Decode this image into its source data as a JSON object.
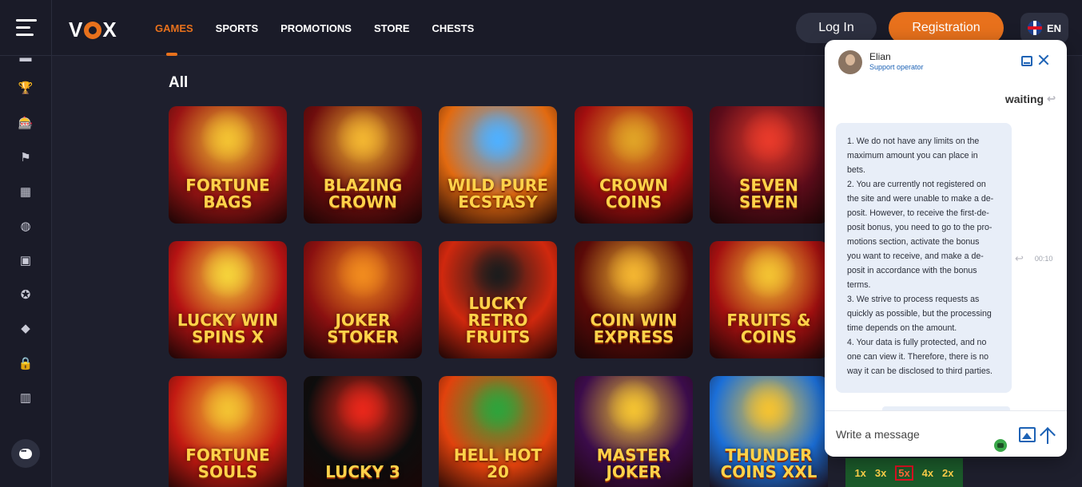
{
  "header": {
    "logo": "VOX",
    "nav": [
      "GAMES",
      "SPORTS",
      "PROMOTIONS",
      "STORE",
      "CHESTS"
    ],
    "active_nav": "GAMES",
    "login_label": "Log In",
    "register_label": "Registration",
    "language": "EN"
  },
  "sidebar": {
    "icons": [
      "menu-partial-icon",
      "trophy-icon",
      "casino-icon",
      "flag-icon",
      "calendar-icon",
      "basketball-icon",
      "tv-icon",
      "award-icon",
      "diamond-icon",
      "lock-icon",
      "leaderboard-icon"
    ],
    "chat_icon": "chat-bubble-icon"
  },
  "main": {
    "section_title": "All",
    "games": [
      {
        "title": "FORTUNE BAGS",
        "bg": "#9a1414",
        "accent": "#f3c232"
      },
      {
        "title": "BLAZING CROWN",
        "bg": "#6e0d0d",
        "accent": "#f2b531"
      },
      {
        "title": "WILD PURE ECSTASY",
        "bg": "#e26a10",
        "accent": "#4fb0ff"
      },
      {
        "title": "CROWN COINS",
        "bg": "#a30f0f",
        "accent": "#e0a326"
      },
      {
        "title": "SEVEN SEVEN",
        "bg": "#5c0c1a",
        "accent": "#e83a2a"
      },
      {
        "title": "LUCKY WIN SPINS X",
        "bg": "#b51313",
        "accent": "#f5d23a"
      },
      {
        "title": "JOKER STOKER",
        "bg": "#8a1010",
        "accent": "#f18b1e"
      },
      {
        "title": "LUCKY RETRO FRUITS",
        "bg": "#d0280e",
        "accent": "#1c1c1c"
      },
      {
        "title": "COIN WIN EXPRESS",
        "bg": "#5a0a08",
        "accent": "#f3b531"
      },
      {
        "title": "FRUITS & COINS",
        "bg": "#a31010",
        "accent": "#f3c232"
      },
      {
        "title": "FORTUNE SOULS",
        "bg": "#c21a12",
        "accent": "#f3c232"
      },
      {
        "title": "Lucky 3",
        "bg": "#0d0d0d",
        "accent": "#e8271a"
      },
      {
        "title": "HELL HOT 20",
        "bg": "#e1420d",
        "accent": "#2fa33b"
      },
      {
        "title": "MASTER JOKER",
        "bg": "#3b0c4a",
        "accent": "#f3c232"
      },
      {
        "title": "THUNDER COINS XXL",
        "bg": "#1b6fd8",
        "accent": "#f3c232"
      }
    ]
  },
  "chat": {
    "operator_name": "Elian",
    "operator_role": "Support operator",
    "status": "waiting",
    "message_lines": [
      "1. We do not have any limits on the",
      "maximum amount you can place in",
      "bets.",
      "2. You are currently not registered on",
      "the site and were unable to make a de-",
      "posit. However, to receive the first-de-",
      "posit bonus, you need to go to the pro-",
      "motions section, activate the bonus",
      "you want to receive, and make a de-",
      "posit in accordance with the bonus",
      "terms.",
      "3. We strive to process requests as",
      "quickly as possible, but the processing",
      "time depends on the amount.",
      "4. Your data is fully protected, and no",
      "one can view it. Therefore, there is no",
      "way it can be disclosed to third parties."
    ],
    "message_time": "00:10",
    "input_placeholder": "Write a message"
  },
  "mini_game": {
    "items": [
      "1x",
      "3x",
      "5x",
      "4x",
      "2x"
    ],
    "highlighted": "5x"
  },
  "colors": {
    "accent": "#e8711c",
    "bg": "#1e1f2d",
    "chat_link": "#1c62b5"
  }
}
